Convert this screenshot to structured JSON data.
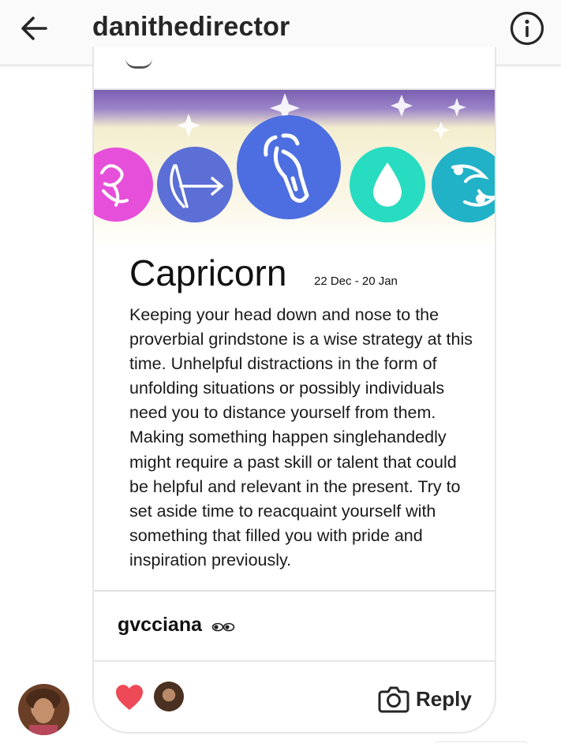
{
  "header": {
    "title": "danithedirector",
    "back_icon": "arrow-left-icon",
    "info_icon": "info-icon"
  },
  "shared_post": {
    "sign_title": "Capricorn",
    "sign_dates": "22 Dec - 20 Jan",
    "horoscope_text": "Keeping your head down and nose to the proverbial grindstone is a wise strategy at this time. Unhelpful distractions in the form of unfolding situations or possibly individuals need you to distance yourself from them. Making something happen singlehandedly might require a past skill or talent that could be helpful and relevant in the present. Try to set aside time to reacquaint yourself with something that filled you with pride and inspiration previously.",
    "zodiac_icons": [
      "scorpio-icon",
      "sagittarius-icon",
      "capricorn-icon",
      "aquarius-icon",
      "pisces-icon"
    ],
    "colors": {
      "scorpio": "#e64fd9",
      "sagittarius": "#5b6fd6",
      "capricorn": "#4d6ee0",
      "aquarius": "#27dcc0",
      "pisces": "#22b2c8"
    }
  },
  "message": {
    "sender": "gvcciana",
    "emoji": "👀"
  },
  "actions": {
    "reply_label": "Reply",
    "heart_icon": "heart-icon",
    "camera_icon": "camera-icon",
    "heart_color": "#ed4956"
  }
}
